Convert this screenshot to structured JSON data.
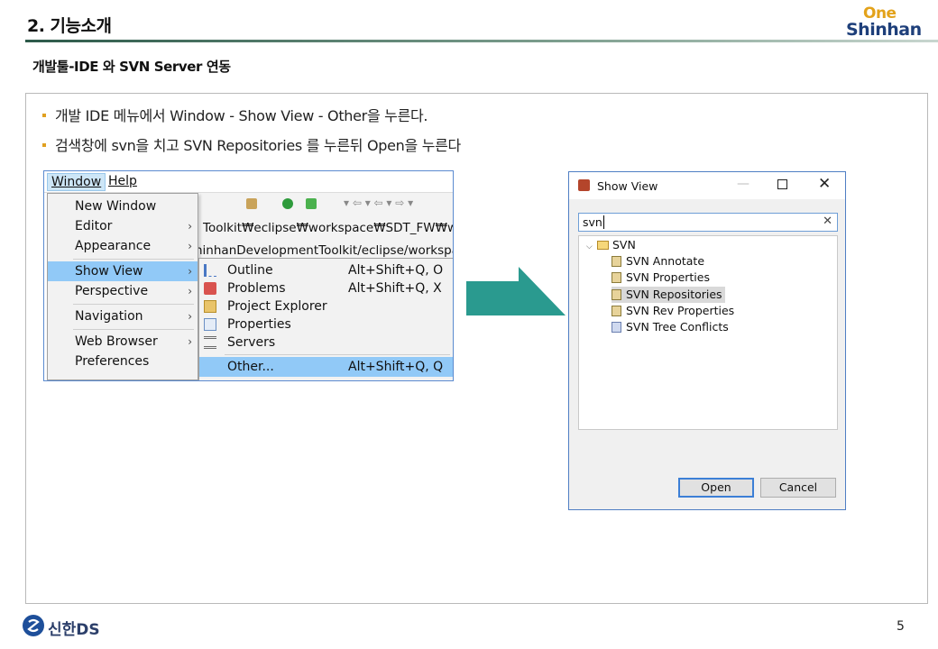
{
  "header": {
    "section_title": "2. 기능소개",
    "logo_top": "One",
    "logo_bottom": "Shinhan",
    "sub_title": "개발툴-IDE 와 SVN Server 연동"
  },
  "bullets": [
    "개발 IDE 메뉴에서 Window - Show View - Other을 누른다.",
    "검색창에 svn을 치고 SVN Repositories 를 누른뒤 Open을 누른다"
  ],
  "menu_shot": {
    "menubar": [
      "Window",
      "Help"
    ],
    "window_menu": [
      {
        "label": "New Window",
        "arrow": ""
      },
      {
        "label": "Editor",
        "arrow": "›"
      },
      {
        "label": "Appearance",
        "arrow": "›"
      },
      {
        "label": "Show View",
        "arrow": "›"
      },
      {
        "label": "Perspective",
        "arrow": "›"
      },
      {
        "label": "Navigation",
        "arrow": "›"
      },
      {
        "label": "Web Browser",
        "arrow": "›"
      },
      {
        "label": "Preferences",
        "arrow": ""
      }
    ],
    "path_line1": "Toolkit₩eclipse₩workspace₩SDT_FW₩welcon",
    "path_line2": "hinhanDevelopmentToolkit/eclipse/workspace",
    "show_view_submenu": [
      {
        "label": "Outline",
        "shortcut": "Alt+Shift+Q, O",
        "icon": "outline-icon"
      },
      {
        "label": "Problems",
        "shortcut": "Alt+Shift+Q, X",
        "icon": "problems-icon"
      },
      {
        "label": "Project Explorer",
        "shortcut": "",
        "icon": "project-explorer-icon"
      },
      {
        "label": "Properties",
        "shortcut": "",
        "icon": "properties-icon"
      },
      {
        "label": "Servers",
        "shortcut": "",
        "icon": "servers-icon"
      },
      {
        "label": "Other...",
        "shortcut": "Alt+Shift+Q, Q",
        "icon": ""
      }
    ]
  },
  "dialog": {
    "title": "Show View",
    "filter_value": "svn",
    "folder": "SVN",
    "items": [
      "SVN Annotate",
      "SVN Properties",
      "SVN Repositories",
      "SVN Rev Properties",
      "SVN Tree Conflicts"
    ],
    "open_label": "Open",
    "cancel_label": "Cancel"
  },
  "footer": {
    "company": "신한DS",
    "page_number": "5"
  },
  "colors": {
    "arrow": "#2a9a8f",
    "highlight": "#91c9f7",
    "bullet": "#e0a020"
  }
}
